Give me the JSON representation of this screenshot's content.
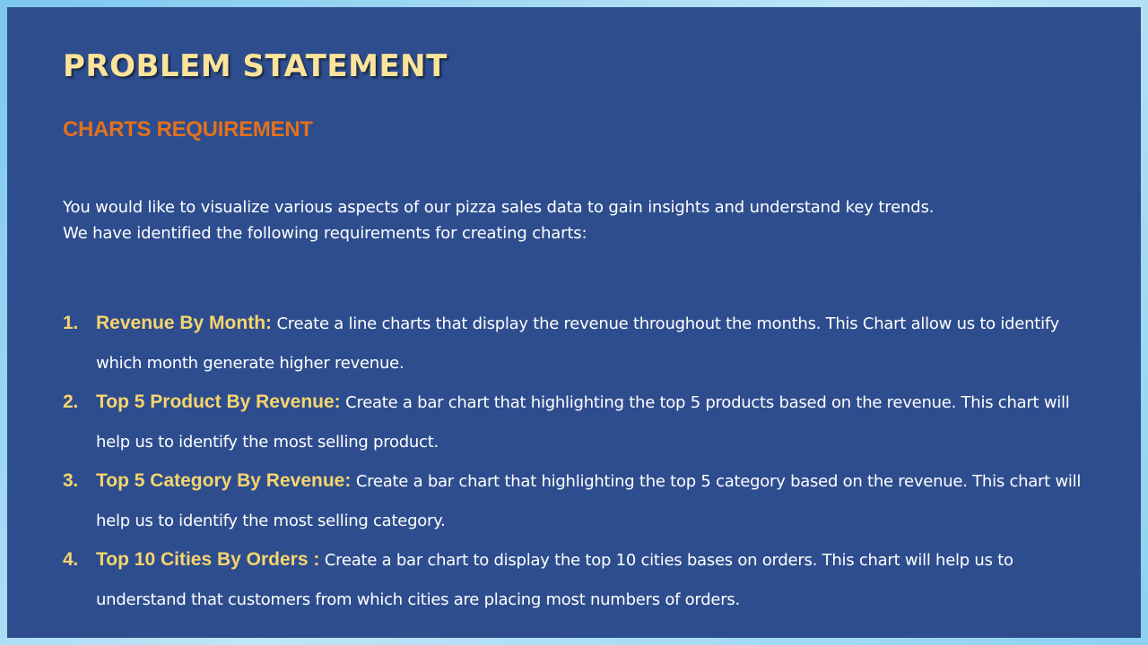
{
  "slide": {
    "title": "PROBLEM STATEMENT",
    "subtitle": "CHARTS REQUIREMENT",
    "intro": "You would like to visualize various aspects of our pizza sales data to gain insights and understand key trends. We have identified the following requirements for creating charts:",
    "requirements": [
      {
        "number": "1.",
        "label": "Revenue By Month:",
        "text": " Create a line charts that display the revenue throughout the months. This Chart allow us to identify which month generate higher revenue."
      },
      {
        "number": "2.",
        "label": "Top 5 Product By Revenue:",
        "text": " Create a bar chart that highlighting the top 5 products based on the revenue. This chart will help us to identify the most selling product."
      },
      {
        "number": "3.",
        "label": "Top 5 Category By Revenue:",
        "text": " Create a bar chart that highlighting the top 5 category based on the revenue. This chart will help us to identify the most selling category."
      },
      {
        "number": "4.",
        "label": "Top 10 Cities By Orders :",
        "text": " Create a bar chart to display the top 10 cities bases on orders. This chart will help us to understand that customers from which cities are placing most numbers of orders."
      }
    ]
  },
  "colors": {
    "slide_background": "#2e4d8e",
    "title": "#fbe39a",
    "subtitle": "#e2711d",
    "label": "#f7d56e",
    "body_text": "#ffffff"
  }
}
